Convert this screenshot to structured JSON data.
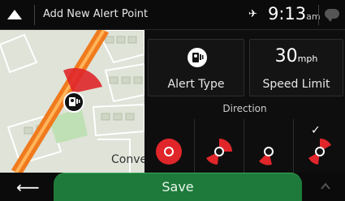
{
  "header": {
    "title": "Add New Alert Point",
    "time": "9:13",
    "ampm": "am",
    "gps_symbol": "✈"
  },
  "map": {
    "street_label": "Conve"
  },
  "panel": {
    "alert_type_label": "Alert Type",
    "speed_value": "30",
    "speed_unit": "mph",
    "speed_label": "Speed Limit",
    "direction_label": "Direction",
    "direction_options": [
      "all directions",
      "one direction",
      "one direction",
      "two directions"
    ],
    "selected_direction_index": 3,
    "check_mark": "✓"
  },
  "footer": {
    "back_symbol": "⟵",
    "save_label": "Save"
  },
  "colors": {
    "accent_red": "#e0262a",
    "save_green": "#1e7a3a",
    "road_orange": "#f07a1e"
  }
}
